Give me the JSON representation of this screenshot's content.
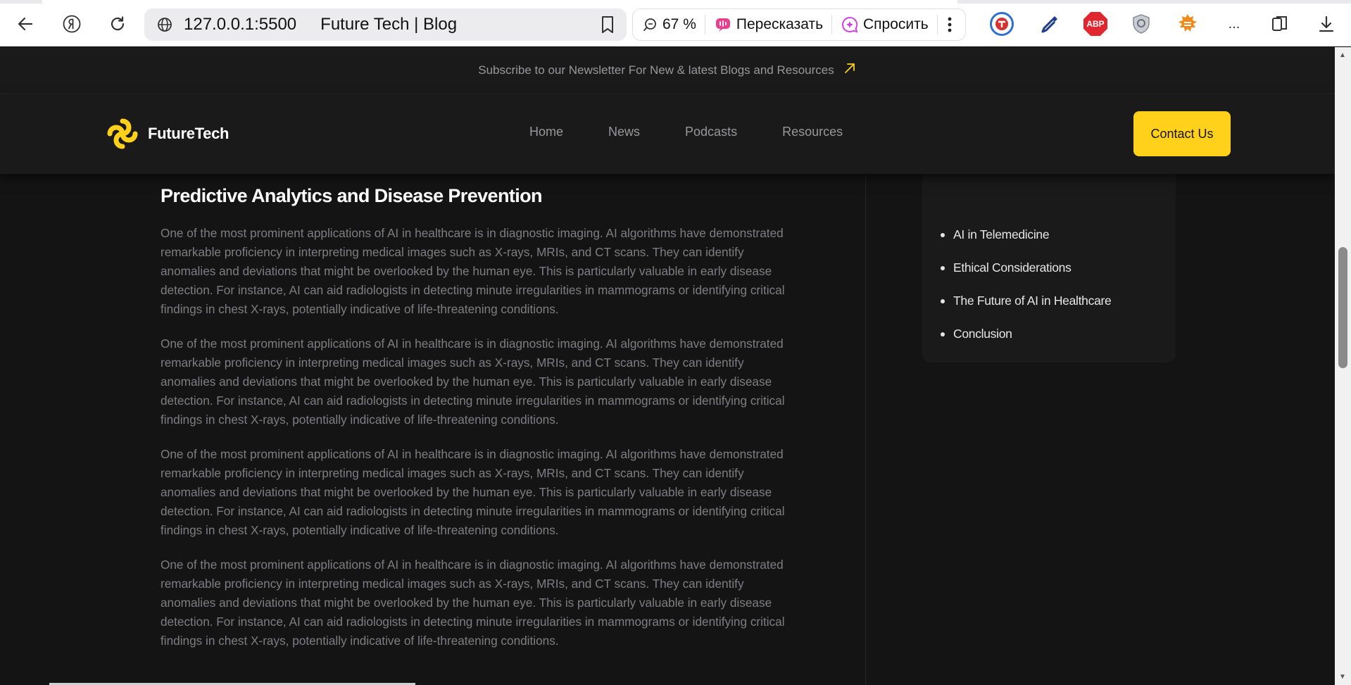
{
  "browser": {
    "url": "127.0.0.1:5500",
    "page_title": "Future Tech | Blog",
    "zoom": "67 %",
    "retell_label": "Пересказать",
    "ask_label": "Спросить",
    "more_label": "...",
    "abp_label": "ABP"
  },
  "site": {
    "newsletter_text": "Subscribe to our Newsletter For New & latest Blogs and Resources",
    "logo_text": "FutureTech",
    "nav": [
      "Home",
      "News",
      "Podcasts",
      "Resources"
    ],
    "contact_label": "Contact Us",
    "colors": {
      "accent": "#ffd11a",
      "background": "#141414",
      "surface": "#1a1a1a",
      "muted_text": "#98989a"
    }
  },
  "article": {
    "heading": "Predictive Analytics and Disease Prevention",
    "paragraphs": [
      "One of the most prominent applications of AI in healthcare is in diagnostic imaging. AI algorithms have demonstrated remarkable proficiency in interpreting medical images such as X-rays, MRIs, and CT scans. They can identify anomalies and deviations that might be overlooked by the human eye. This is particularly valuable in early disease detection. For instance, AI can aid radiologists in detecting minute irregularities in mammograms or identifying critical findings in chest X-rays, potentially indicative of life-threatening conditions.",
      "One of the most prominent applications of AI in healthcare is in diagnostic imaging. AI algorithms have demonstrated remarkable proficiency in interpreting medical images such as X-rays, MRIs, and CT scans. They can identify anomalies and deviations that might be overlooked by the human eye. This is particularly valuable in early disease detection. For instance, AI can aid radiologists in detecting minute irregularities in mammograms or identifying critical findings in chest X-rays, potentially indicative of life-threatening conditions.",
      "One of the most prominent applications of AI in healthcare is in diagnostic imaging. AI algorithms have demonstrated remarkable proficiency in interpreting medical images such as X-rays, MRIs, and CT scans. They can identify anomalies and deviations that might be overlooked by the human eye. This is particularly valuable in early disease detection. For instance, AI can aid radiologists in detecting minute irregularities in mammograms or identifying critical findings in chest X-rays, potentially indicative of life-threatening conditions.",
      "One of the most prominent applications of AI in healthcare is in diagnostic imaging. AI algorithms have demonstrated remarkable proficiency in interpreting medical images such as X-rays, MRIs, and CT scans. They can identify anomalies and deviations that might be overlooked by the human eye. This is particularly valuable in early disease detection. For instance, AI can aid radiologists in detecting minute irregularities in mammograms or identifying critical findings in chest X-rays, potentially indicative of life-threatening conditions."
    ]
  },
  "toc": {
    "items": [
      "AI in Telemedicine",
      "Ethical Considerations",
      "The Future of AI in Healthcare",
      "Conclusion"
    ]
  },
  "icons": {
    "back": "arrow-left-icon",
    "yandex": "yandex-icon",
    "reload": "reload-icon",
    "site_info": "globe-icon",
    "bookmark": "bookmark-icon",
    "zoom": "zoom-icon",
    "retell": "retell-icon",
    "ask": "sparkle-chat-icon",
    "menu": "kebab-icon",
    "newsletter_arrow": "arrow-up-right-icon",
    "download": "download-icon"
  }
}
